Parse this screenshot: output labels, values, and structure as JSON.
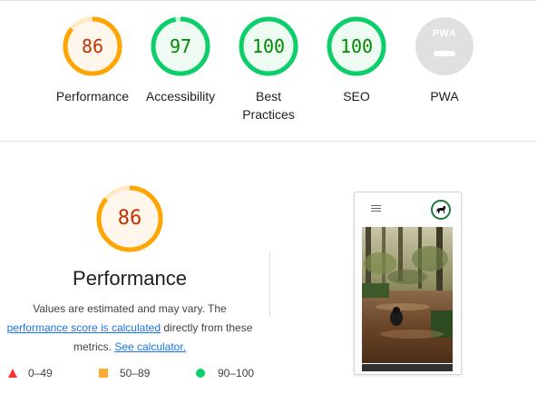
{
  "gauges": [
    {
      "label": "Performance",
      "value": "86",
      "score": 0.86,
      "color": "#ffa400",
      "fill": "#fff7ec",
      "text_color": "#c33300"
    },
    {
      "label": "Accessibility",
      "value": "97",
      "score": 0.97,
      "color": "#0cce6b",
      "fill": "#eefbf2",
      "text_color": "#008800"
    },
    {
      "label": "Best Practices",
      "value": "100",
      "score": 1.0,
      "color": "#0cce6b",
      "fill": "#eefbf2",
      "text_color": "#008800"
    },
    {
      "label": "SEO",
      "value": "100",
      "score": 1.0,
      "color": "#0cce6b",
      "fill": "#eefbf2",
      "text_color": "#008800"
    },
    {
      "label": "PWA",
      "badge_text": "PWA",
      "color": "#e0e0e0"
    }
  ],
  "performance": {
    "score": "86",
    "title": "Performance",
    "desc_pre": "Values are estimated and may vary. The",
    "desc_link": "performance score is calculated",
    "desc_mid": "directly from these metrics.",
    "desc_link2": "See calculator."
  },
  "legend": [
    {
      "range": "0–49",
      "shape": "triangle",
      "color": "#ff3333"
    },
    {
      "range": "50–89",
      "shape": "square",
      "color": "#ffaa33"
    },
    {
      "range": "90–100",
      "shape": "circle",
      "color": "#0cce6b"
    }
  ],
  "screenshot": {
    "menu_icon": "hamburger-menu-icon",
    "logo_icon": "dog-logo-icon",
    "image": "dog-in-forest-stream-photo"
  }
}
